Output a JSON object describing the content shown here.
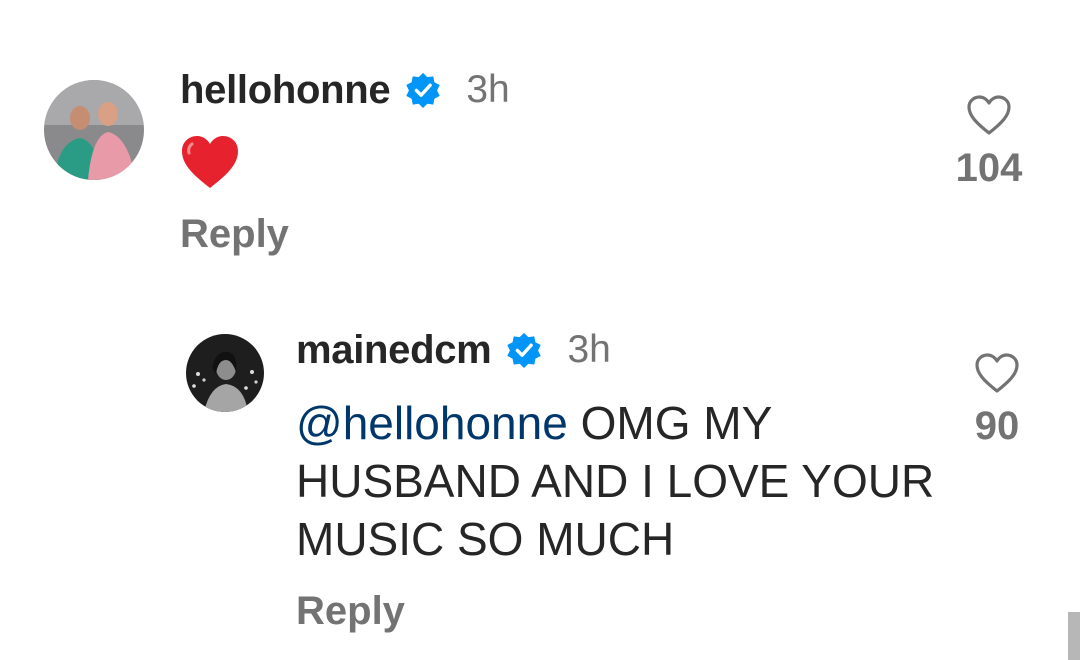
{
  "comments": [
    {
      "username": "hellohonne",
      "verified": true,
      "timestamp": "3h",
      "body_emoji": "red-heart",
      "reply_label": "Reply",
      "likes": "104"
    }
  ],
  "reply_comment": {
    "username": "mainedcm",
    "verified": true,
    "timestamp": "3h",
    "mention": "@hellohonne",
    "body_line1_rest": " OMG MY",
    "body_line2": "HUSBAND AND I LOVE YOUR",
    "body_line3": "MUSIC SO MUCH",
    "reply_label": "Reply",
    "likes": "90"
  },
  "colors": {
    "verified_blue": "#0095f6",
    "heart_red": "#e7222f",
    "mention_blue": "#00376b",
    "muted_gray": "#737373"
  }
}
